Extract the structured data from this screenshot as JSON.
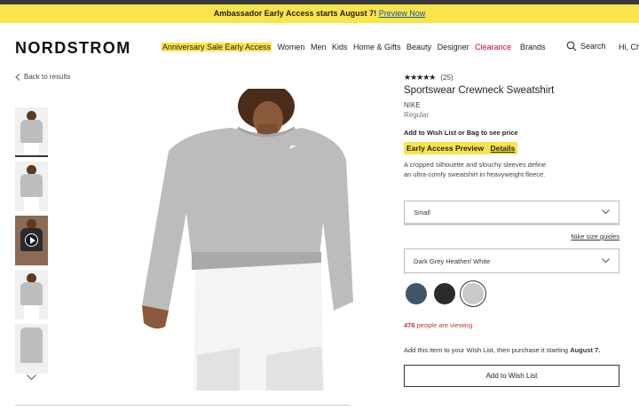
{
  "promo": {
    "text": "Ambassador Early Access starts August 7!",
    "link": "Preview Now"
  },
  "header": {
    "logo": "NORDSTROM",
    "nav": [
      "Anniversary Sale Early Access",
      "Women",
      "Men",
      "Kids",
      "Home & Gifts",
      "Beauty",
      "Designer",
      "Clearance"
    ],
    "brands": "Brands",
    "search": "Search",
    "greeting": "Hi, Ch"
  },
  "back_link": "Back to results",
  "thumbnails": {
    "count": 5,
    "active_index": 0
  },
  "product": {
    "rating": 4.5,
    "stars": "★★★★★",
    "review_count": "(25)",
    "title": "Sportswear Crewneck Sweatshirt",
    "brand": "NIKE",
    "fit": "Regular",
    "wish_msg": "Add to Wish List or Bag to see price",
    "early_access": "Early Access Preview",
    "details_link": "Details",
    "description": "A cropped silhouette and slouchy sleeves define an ultra-comfy sweatshirt in heavyweight fleece.",
    "size_value": "Small",
    "size_guide": "Nike size guides",
    "color_value": "Dark Grey Heather/ White",
    "swatches": [
      "#3d5766",
      "#2b2b2b",
      "#c9c9c9"
    ],
    "selected_swatch": 2,
    "viewing_count": "476",
    "viewing_text": "people are viewing",
    "wish_info_text": "Add this item to your Wish List, then purchase it starting",
    "wish_info_date": "August 7.",
    "wish_button": "Add to Wish List"
  },
  "colors": {
    "promo_bg": "#f9e44c",
    "clearance": "#d6002b",
    "viewing": "#c0392b"
  }
}
